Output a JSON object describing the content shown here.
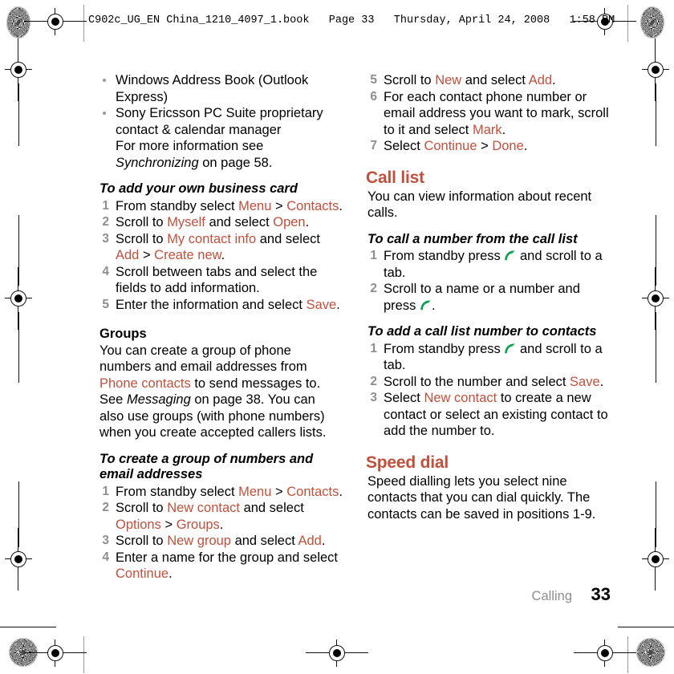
{
  "header": {
    "text": "C902c_UG_EN China_1210_4097_1.book   Page 33   Thursday, April 24, 2008   1:58 PM"
  },
  "colors": {
    "accent": "#C0503C",
    "step_number": "#8E8E8E",
    "call_icon": "#12A050",
    "body_text": "#000000"
  },
  "footer": {
    "chapter": "Calling",
    "page_number": "33"
  },
  "left_column": {
    "bullets": [
      "Windows Address Book (Outlook Express)",
      "Sony Ericsson PC Suite proprietary contact & calendar manager"
    ],
    "bullet_note_prefix": "For more information see ",
    "bullet_note_italic": "Synchronizing",
    "bullet_note_suffix": " on page 58.",
    "task_business_card": {
      "title": "To add your own business card",
      "steps": [
        {
          "n": "1",
          "parts": [
            {
              "t": "From standby select ",
              "s": "plain"
            },
            {
              "t": "Menu",
              "s": "ui"
            },
            {
              "t": " > ",
              "s": "plain"
            },
            {
              "t": "Contacts",
              "s": "ui"
            },
            {
              "t": ".",
              "s": "plain"
            }
          ]
        },
        {
          "n": "2",
          "parts": [
            {
              "t": "Scroll to ",
              "s": "plain"
            },
            {
              "t": "Myself",
              "s": "ui"
            },
            {
              "t": " and select ",
              "s": "plain"
            },
            {
              "t": "Open",
              "s": "ui"
            },
            {
              "t": ".",
              "s": "plain"
            }
          ]
        },
        {
          "n": "3",
          "parts": [
            {
              "t": "Scroll to ",
              "s": "plain"
            },
            {
              "t": "My contact info",
              "s": "ui"
            },
            {
              "t": " and select ",
              "s": "plain"
            },
            {
              "t": "Add",
              "s": "ui"
            },
            {
              "t": " > ",
              "s": "plain"
            },
            {
              "t": "Create new",
              "s": "ui"
            },
            {
              "t": ".",
              "s": "plain"
            }
          ]
        },
        {
          "n": "4",
          "parts": [
            {
              "t": "Scroll between tabs and select the fields to add information.",
              "s": "plain"
            }
          ]
        },
        {
          "n": "5",
          "parts": [
            {
              "t": "Enter the information and select ",
              "s": "plain"
            },
            {
              "t": "Save",
              "s": "ui"
            },
            {
              "t": ".",
              "s": "plain"
            }
          ]
        }
      ]
    },
    "groups": {
      "heading": "Groups",
      "paragraph_parts": [
        {
          "t": "You can create a group of phone numbers and email addresses from ",
          "s": "plain"
        },
        {
          "t": "Phone contacts",
          "s": "ui"
        },
        {
          "t": " to send messages to. See ",
          "s": "plain"
        },
        {
          "t": "Messaging",
          "s": "it"
        },
        {
          "t": " on page 38. You can also use groups (with phone numbers) when you create accepted callers lists.",
          "s": "plain"
        }
      ]
    },
    "task_create_group": {
      "title": "To create a group of numbers and email addresses",
      "steps": [
        {
          "n": "1",
          "parts": [
            {
              "t": "From standby select ",
              "s": "plain"
            },
            {
              "t": "Menu",
              "s": "ui"
            },
            {
              "t": " > ",
              "s": "plain"
            },
            {
              "t": "Contacts",
              "s": "ui"
            },
            {
              "t": ".",
              "s": "plain"
            }
          ]
        },
        {
          "n": "2",
          "parts": [
            {
              "t": "Scroll to ",
              "s": "plain"
            },
            {
              "t": "New contact",
              "s": "ui"
            },
            {
              "t": " and select ",
              "s": "plain"
            },
            {
              "t": "Options",
              "s": "ui"
            },
            {
              "t": " > ",
              "s": "plain"
            },
            {
              "t": "Groups",
              "s": "ui"
            },
            {
              "t": ".",
              "s": "plain"
            }
          ]
        },
        {
          "n": "3",
          "parts": [
            {
              "t": "Scroll to ",
              "s": "plain"
            },
            {
              "t": "New group",
              "s": "ui"
            },
            {
              "t": " and select ",
              "s": "plain"
            },
            {
              "t": "Add",
              "s": "ui"
            },
            {
              "t": ".",
              "s": "plain"
            }
          ]
        },
        {
          "n": "4",
          "parts": [
            {
              "t": "Enter a name for the group and select ",
              "s": "plain"
            },
            {
              "t": "Continue",
              "s": "ui"
            },
            {
              "t": ".",
              "s": "plain"
            }
          ]
        }
      ]
    }
  },
  "right_column": {
    "task_create_group_continued": {
      "steps": [
        {
          "n": "5",
          "parts": [
            {
              "t": "Scroll to ",
              "s": "plain"
            },
            {
              "t": "New",
              "s": "ui"
            },
            {
              "t": " and select ",
              "s": "plain"
            },
            {
              "t": "Add",
              "s": "ui"
            },
            {
              "t": ".",
              "s": "plain"
            }
          ]
        },
        {
          "n": "6",
          "parts": [
            {
              "t": "For each contact phone number or email address you want to mark, scroll to it and select ",
              "s": "plain"
            },
            {
              "t": "Mark",
              "s": "ui"
            },
            {
              "t": ".",
              "s": "plain"
            }
          ]
        },
        {
          "n": "7",
          "parts": [
            {
              "t": "Select ",
              "s": "plain"
            },
            {
              "t": "Continue",
              "s": "ui"
            },
            {
              "t": " > ",
              "s": "plain"
            },
            {
              "t": "Done",
              "s": "ui"
            },
            {
              "t": ".",
              "s": "plain"
            }
          ]
        }
      ]
    },
    "call_list": {
      "heading": "Call list",
      "paragraph": "You can view information about recent calls.",
      "task_call_number": {
        "title": "To call a number from the call list",
        "steps": [
          {
            "n": "1",
            "parts": [
              {
                "t": "From standby press ",
                "s": "plain"
              },
              {
                "t": "call-icon",
                "s": "icon"
              },
              {
                "t": " and scroll to a tab.",
                "s": "plain"
              }
            ]
          },
          {
            "n": "2",
            "parts": [
              {
                "t": "Scroll to a name or a number and press ",
                "s": "plain"
              },
              {
                "t": "call-icon",
                "s": "icon"
              },
              {
                "t": ".",
                "s": "plain"
              }
            ]
          }
        ]
      },
      "task_add_to_contacts": {
        "title": "To add a call list number to contacts",
        "steps": [
          {
            "n": "1",
            "parts": [
              {
                "t": "From standby press ",
                "s": "plain"
              },
              {
                "t": "call-icon",
                "s": "icon"
              },
              {
                "t": " and scroll to a tab.",
                "s": "plain"
              }
            ]
          },
          {
            "n": "2",
            "parts": [
              {
                "t": "Scroll to the number and select ",
                "s": "plain"
              },
              {
                "t": "Save",
                "s": "ui"
              },
              {
                "t": ".",
                "s": "plain"
              }
            ]
          },
          {
            "n": "3",
            "parts": [
              {
                "t": "Select ",
                "s": "plain"
              },
              {
                "t": "New contact",
                "s": "ui"
              },
              {
                "t": " to create a new contact or select an existing contact to add the number to.",
                "s": "plain"
              }
            ]
          }
        ]
      }
    },
    "speed_dial": {
      "heading": "Speed dial",
      "paragraph": "Speed dialling lets you select nine contacts that you can dial quickly. The contacts can be saved in positions 1-9."
    }
  }
}
